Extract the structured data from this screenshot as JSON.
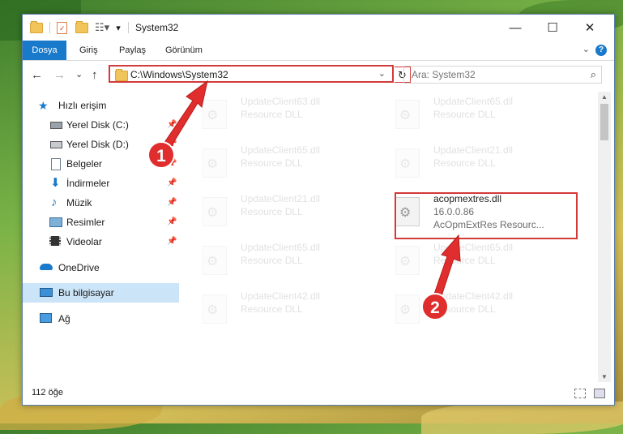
{
  "window": {
    "title": "System32",
    "controls": {
      "minimize": "—",
      "maximize": "☐",
      "close": "✕"
    }
  },
  "quick_access_toolbar": {
    "icons": [
      "folder-icon",
      "properties-icon",
      "new-folder-icon",
      "customize-icon"
    ]
  },
  "ribbon": {
    "tabs": [
      {
        "label": "Dosya",
        "active": true
      },
      {
        "label": "Giriş",
        "active": false
      },
      {
        "label": "Paylaş",
        "active": false
      },
      {
        "label": "Görünüm",
        "active": false
      }
    ]
  },
  "navigation": {
    "back": "←",
    "forward": "→",
    "recent": "⌄",
    "up": "↑",
    "address": "C:\\Windows\\System32",
    "refresh": "↻"
  },
  "search": {
    "placeholder": "Ara: System32"
  },
  "sidebar": {
    "items": [
      {
        "label": "Hızlı erişim",
        "icon": "star-icon",
        "pinned": false
      },
      {
        "label": "Yerel Disk (C:)",
        "icon": "drive-icon",
        "pinned": true
      },
      {
        "label": "Yerel Disk (D:)",
        "icon": "drive-icon",
        "pinned": true
      },
      {
        "label": "Belgeler",
        "icon": "documents-icon",
        "pinned": true
      },
      {
        "label": "İndirmeler",
        "icon": "download-icon",
        "pinned": true
      },
      {
        "label": "Müzik",
        "icon": "music-icon",
        "pinned": true
      },
      {
        "label": "Resimler",
        "icon": "pictures-icon",
        "pinned": true
      },
      {
        "label": "Videolar",
        "icon": "video-icon",
        "pinned": true
      },
      {
        "label": "OneDrive",
        "icon": "cloud-icon",
        "pinned": false
      },
      {
        "label": "Bu bilgisayar",
        "icon": "computer-icon",
        "pinned": false,
        "selected": true
      },
      {
        "label": "Ağ",
        "icon": "network-icon",
        "pinned": false
      }
    ]
  },
  "files": [
    {
      "name": "UpdateClient63.dll",
      "desc": "Resource DLL"
    },
    {
      "name": "UpdateClient65.dll",
      "desc": "Resource DLL"
    },
    {
      "name": "UpdateClient65.dll",
      "desc": "Resource DLL"
    },
    {
      "name": "UpdateClient21.dll",
      "desc": "Resource DLL"
    },
    {
      "name": "UpdateClient21.dll",
      "desc": "Resource DLL"
    },
    {
      "name": "acopmextres.dll",
      "desc": "16.0.0.86",
      "desc2": "AcOpmExtRes Resourc...",
      "selected": true
    },
    {
      "name": "UpdateClient65.dll",
      "desc": "Resource DLL"
    },
    {
      "name": "UpdateClient65.dll",
      "desc": "Resource DLL"
    },
    {
      "name": "UpdateClient42.dll",
      "desc": "Resource DLL"
    },
    {
      "name": "UpdateClient42.dll",
      "desc": "Resource DLL"
    }
  ],
  "status": {
    "count": "112 öğe"
  },
  "annotations": {
    "badge1": "1",
    "badge2": "2"
  },
  "colors": {
    "accent": "#1979ca",
    "highlight": "#d33a3a"
  }
}
